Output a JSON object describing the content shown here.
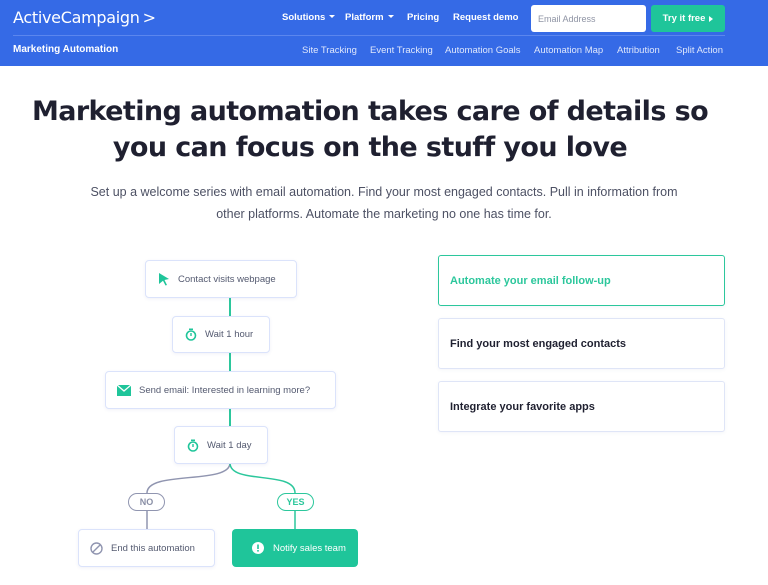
{
  "header": {
    "logo": "ActiveCampaign",
    "logo_symbol": ">",
    "nav": [
      {
        "label": "Solutions",
        "has_dropdown": true
      },
      {
        "label": "Platform",
        "has_dropdown": true
      },
      {
        "label": "Pricing",
        "has_dropdown": false
      },
      {
        "label": "Request demo",
        "has_dropdown": false
      }
    ],
    "email_placeholder": "Email Address",
    "cta_label": "Try it free",
    "section_title": "Marketing Automation",
    "subnav": [
      "Site Tracking",
      "Event Tracking",
      "Automation Goals",
      "Automation Map",
      "Attribution",
      "Split Action"
    ]
  },
  "hero": {
    "headline_line1": "Marketing automation takes care of details so",
    "headline_line2": "you can focus on the stuff you love",
    "description_line1": "Set up a welcome series with email automation. Find your most engaged contacts. Pull in information from",
    "description_line2": "other platforms. Automate the marketing no one has time for."
  },
  "workflow": {
    "steps": [
      {
        "label": "Contact visits webpage",
        "icon": "cursor-icon"
      },
      {
        "label": "Wait 1 hour",
        "icon": "stopwatch-icon"
      },
      {
        "label": "Send email: Interested in learning more?",
        "icon": "envelope-icon"
      },
      {
        "label": "Wait 1 day",
        "icon": "stopwatch-icon"
      }
    ],
    "branch_no": "NO",
    "branch_yes": "YES",
    "no_action": {
      "label": "End this automation",
      "icon": "prohibited-icon"
    },
    "yes_action": {
      "label": "Notify sales team",
      "icon": "exclamation-icon"
    }
  },
  "features": [
    {
      "label": "Automate your email follow-up",
      "active": true
    },
    {
      "label": "Find your most engaged contacts",
      "active": false
    },
    {
      "label": "Integrate your favorite apps",
      "active": false
    }
  ],
  "colors": {
    "header_blue": "#356ae6",
    "accent_green": "#1fc59a",
    "branch_gray": "#9095b0"
  }
}
